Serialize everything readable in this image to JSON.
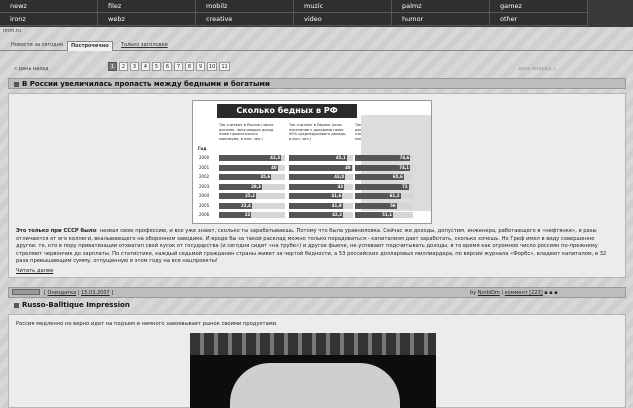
{
  "nav": {
    "row1": [
      "newz",
      "filez",
      "mobilz",
      "muzic",
      "palmz",
      "gamez"
    ],
    "row2": [
      "ironz",
      "webz",
      "creative",
      "video",
      "humor",
      "other"
    ]
  },
  "site": "nnm.ru",
  "tabs": [
    "Новости за сегодня",
    "Построчечно",
    "Только заголовки"
  ],
  "pager": {
    "prev": "« день назад",
    "next": "день вперед »",
    "pages": [
      "1",
      "2",
      "3",
      "4",
      "5",
      "6",
      "7",
      "8",
      "9",
      "10",
      "11"
    ],
    "current": "1"
  },
  "article1": {
    "title": "В России увеличилась пропасть между бедными и богатыми",
    "lead": "Это только при СССР было",
    "body": ": назвал свою профессию, и все уже знают, сколько ты зарабатываешь. Потому что была уравниловка. Сейчас же доходы, допустим, инженера, работающего в «нефтянке», в разы отличаются от его коллеги, вкалывающего на оборонном заводике. И вроде бы за такой расклад можно только порадоваться - капитализм дает заработать, сколько хочешь. Но Греф имел в виду совершенно другое: те, кто в пору приватизации отхватил свой кусок от государства (и сегодня сидит «на трубе») и другое фьюче, не успевают подсчитывать доходы, в то время как огромное число россиян по-прежнему стреляют червончик до зарплаты. По статистике, каждый седьмой гражданин страны живет за чертой бедности, а 53 российских долларовых миллиардера, по версии журнала «Форбс», владеют капиталом, в 32 раза превышающим сумму, отпущенную в этом году на все нацпроекты!",
    "read_more": "Читать далее"
  },
  "infographic": {
    "title": "Сколько бедных в РФ",
    "year_header": "Год",
    "columns": [
      "Так считают в России (число россиян, получающих доход ниже прожиточного минимума, в млн. чел.)",
      "Так считают в Европе (если население с доходами ниже 50% среднедушевого дохода, в млн. чел.)",
      "Так думают сами люди (по данным опросов россиян, считающих себя бедными, в млн. чел.)"
    ],
    "years": [
      "2000",
      "2001",
      "2002",
      "2003",
      "2004",
      "2005",
      "2006"
    ]
  },
  "chart_data": {
    "type": "bar",
    "title": "Сколько бедных в РФ",
    "categories": [
      "2000",
      "2001",
      "2002",
      "2003",
      "2004",
      "2005",
      "2006"
    ],
    "series": [
      {
        "name": "Так считают в России",
        "values": [
          42.3,
          40,
          35.6,
          29.3,
          25.2,
          22.4,
          22
        ]
      },
      {
        "name": "Так считают в Европе",
        "values": [
          45.1,
          49,
          43.8,
          43,
          41.6,
          41.9,
          42.2
        ]
      },
      {
        "name": "Так думают сами люди",
        "values": [
          74.6,
          74.1,
          65.6,
          72,
          61.2,
          56,
          51.1
        ]
      }
    ]
  },
  "article2": {
    "title": "Russo-Balltique Impression",
    "category": "Ониздатка",
    "date": "15.03.2007",
    "by": "by",
    "author": "NorbiDm",
    "comments": "коммент [223]",
    "intro": "Россия медленно но верно идет на подъем и немного завоевывает рынок своими продуктами."
  }
}
